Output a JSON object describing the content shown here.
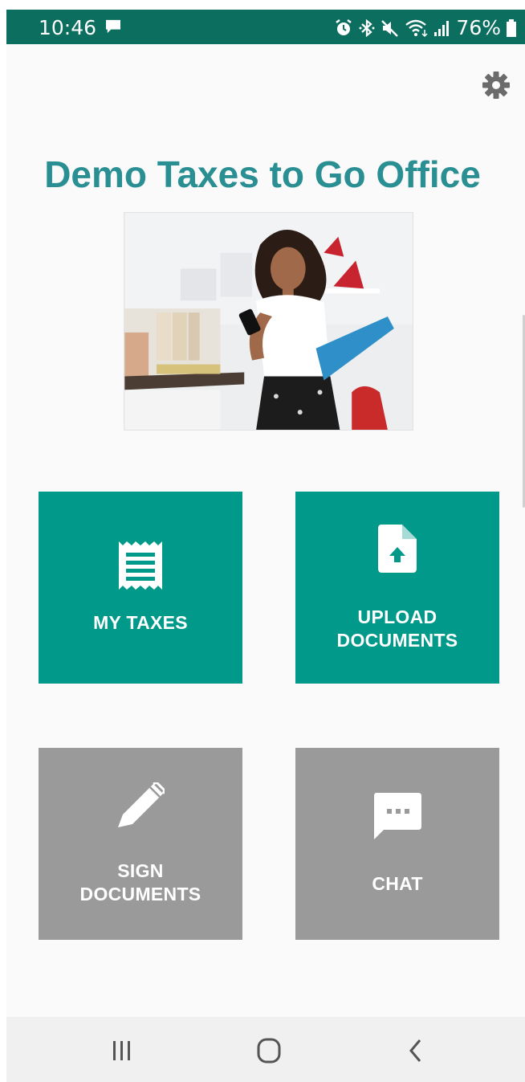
{
  "status_bar": {
    "time": "10:46",
    "battery": "76%",
    "icons": [
      "message-icon",
      "alarm-icon",
      "bluetooth-icon",
      "mute-icon",
      "wifi-icon",
      "signal-icon",
      "battery-icon"
    ],
    "background": "#0b6e5f"
  },
  "header": {
    "settings_icon": "gear-icon"
  },
  "app": {
    "title": "Demo Taxes to Go Office",
    "title_color": "#2a8f93"
  },
  "tiles": [
    {
      "label": "MY TAXES",
      "icon": "receipt-icon",
      "color": "#00998a"
    },
    {
      "label": "UPLOAD\nDOCUMENTS",
      "icon": "file-upload-icon",
      "color": "#00998a"
    },
    {
      "label": "SIGN\nDOCUMENTS",
      "icon": "pen-icon",
      "color": "#9a9a9a"
    },
    {
      "label": "CHAT",
      "icon": "chat-icon",
      "color": "#9a9a9a"
    }
  ],
  "nav_bar": {
    "buttons": [
      "recents-icon",
      "home-icon",
      "back-icon"
    ]
  }
}
